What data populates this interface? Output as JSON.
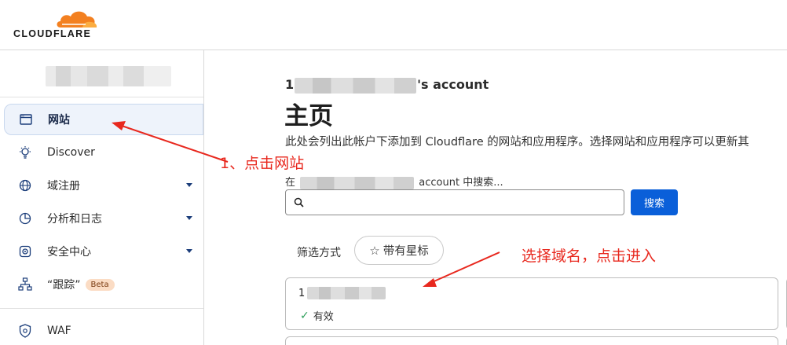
{
  "brand": {
    "wordmark": "CLOUDFLARE",
    "accent": "#f38020"
  },
  "sidebar": {
    "items": [
      {
        "label": "网站",
        "icon": "browser-window-icon",
        "active": true
      },
      {
        "label": "Discover",
        "icon": "lightbulb-icon"
      },
      {
        "label": "域注册",
        "icon": "globe-icon",
        "expandable": true
      },
      {
        "label": "分析和日志",
        "icon": "pie-chart-icon",
        "expandable": true
      },
      {
        "label": "安全中心",
        "icon": "security-center-icon",
        "expandable": true
      },
      {
        "label": "“跟踪”",
        "icon": "trace-icon",
        "badge": "Beta"
      },
      {
        "label": "WAF",
        "icon": "shield-icon"
      }
    ]
  },
  "main": {
    "account_prefix": "1",
    "account_suffix": "'s account",
    "page_title": "主页",
    "description": "此处会列出此帐户下添加到 Cloudflare 的网站和应用程序。选择网站和应用程序可以更新其",
    "search_label_prefix": "在",
    "search_label_suffix": "account 中搜索...",
    "search_placeholder": "",
    "search_button": "搜索",
    "filter_label": "筛选方式",
    "starred_filter": "带有星标",
    "domain_card": {
      "name_prefix": "1",
      "status": "有效"
    }
  },
  "annotations": {
    "step1": "1、点击网站",
    "step2": "选择域名，点击进入",
    "color": "#e8281e"
  }
}
